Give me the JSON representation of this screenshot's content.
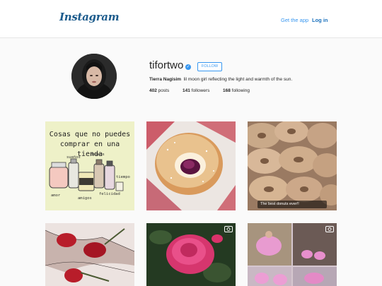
{
  "header": {
    "logo": "Instagram",
    "get_app": "Get the app",
    "login": "Log in"
  },
  "profile": {
    "username": "tifortwo",
    "verified": true,
    "follow_label": "FOLLOW",
    "full_name": "Tierra Nagisim",
    "bio": "lil moon girl reflecting the light and warmth of the sun.",
    "posts_count": "402",
    "posts_label": "posts",
    "followers_count": "141",
    "followers_label": "followers",
    "following_count": "168",
    "following_label": "following"
  },
  "posts": [
    {
      "type": "image",
      "subject": "illustration of jars",
      "line1": "Cosas que no puedes",
      "line2": "comprar en una tienda",
      "jar_labels": [
        "sueños",
        "deseos",
        "amor",
        "amigos",
        "felicidad",
        "tiempo"
      ]
    },
    {
      "type": "image",
      "subject": "jelly donut"
    },
    {
      "type": "image",
      "subject": "glazed donuts",
      "caption": "The best donuts ever!!"
    },
    {
      "type": "image",
      "subject": "roses on fishnet legs"
    },
    {
      "type": "video",
      "subject": "pink rose",
      "icon": "video-camera-icon"
    },
    {
      "type": "video",
      "subject": "dancers in pink costumes",
      "icon": "video-camera-icon"
    }
  ],
  "colors": {
    "accent": "#3897f0",
    "logo": "#1c5b8c",
    "background": "#fafafa"
  }
}
